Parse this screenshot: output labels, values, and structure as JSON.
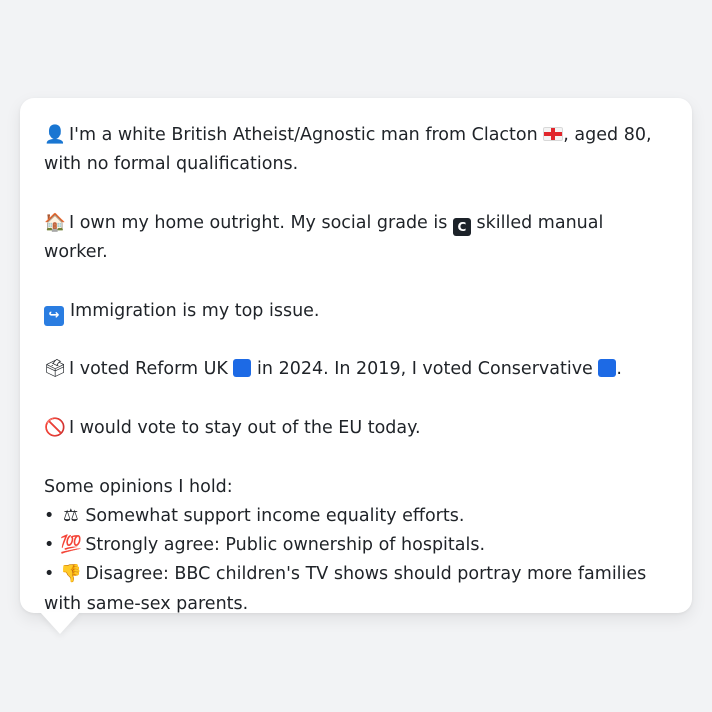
{
  "profile": {
    "p1": {
      "icon": "👤",
      "text_a": "I'm a white British Atheist/Agnostic man from Clacton",
      "flag": "england-flag",
      "text_b": ", aged 80, with no formal qualifications."
    },
    "p2": {
      "icon": "🏠",
      "text_a": "I own my home outright. My social grade is",
      "grade_letter": "C",
      "text_b": "skilled manual worker."
    },
    "p3": {
      "icon": "↪",
      "text": "Immigration is my top issue."
    },
    "p4": {
      "icon": "🗳",
      "text_a": "I voted Reform UK",
      "text_b": "in 2024. In 2019, I voted Conservative",
      "text_c": "."
    },
    "p5": {
      "icon": "🚫",
      "text": "I would vote to stay out of the EU today."
    },
    "opinions": {
      "heading": "Some opinions I hold:",
      "bullet": "•",
      "items": [
        {
          "icon": "⚖",
          "text": "Somewhat support income equality efforts."
        },
        {
          "icon": "💯",
          "text": "Strongly agree: Public ownership of hospitals."
        },
        {
          "icon": "👎",
          "text": "Disagree: BBC children's TV shows should portray more families with same-sex parents."
        }
      ]
    }
  },
  "colors": {
    "background": "#f2f3f5",
    "card": "#ffffff",
    "text": "#1f2328",
    "party_blue": "#1d6ae5"
  }
}
